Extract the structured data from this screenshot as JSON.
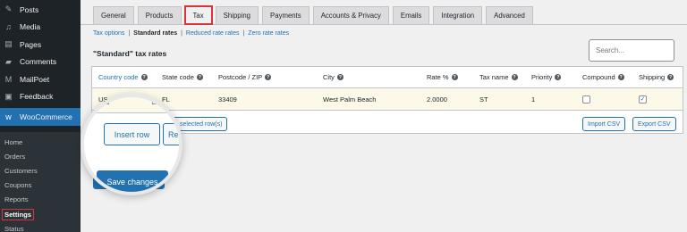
{
  "sidebar": {
    "items": [
      {
        "icon": "pin-icon",
        "glyph": "✎",
        "label": "Posts"
      },
      {
        "icon": "media-icon",
        "glyph": "♫",
        "label": "Media"
      },
      {
        "icon": "pages-icon",
        "glyph": "▤",
        "label": "Pages"
      },
      {
        "icon": "comments-icon",
        "glyph": "▰",
        "label": "Comments"
      },
      {
        "icon": "mailpoet-icon",
        "glyph": "M",
        "label": "MailPoet"
      },
      {
        "icon": "feedback-icon",
        "glyph": "▣",
        "label": "Feedback"
      }
    ],
    "woocommerce": {
      "glyph": "w",
      "label": "WooCommerce"
    },
    "submenu": [
      "Home",
      "Orders",
      "Customers",
      "Coupons",
      "Reports",
      "Settings",
      "Status"
    ]
  },
  "tabs": [
    "General",
    "Products",
    "Tax",
    "Shipping",
    "Payments",
    "Accounts & Privacy",
    "Emails",
    "Integration",
    "Advanced"
  ],
  "subnav": {
    "tax_options": "Tax options",
    "standard": "Standard rates",
    "reduced": "Reduced rate rates",
    "zero": "Zero rate rates",
    "sep": "|"
  },
  "section_title": "\"Standard\" tax rates",
  "search_placeholder": "Search...",
  "table": {
    "headers": [
      "Country code",
      "State code",
      "Postcode / ZIP",
      "City",
      "Rate %",
      "Tax name",
      "Priority",
      "Compound",
      "Shipping"
    ],
    "row": {
      "country": "US",
      "state": "FL",
      "postcode": "33409",
      "city": "West Palm Beach",
      "rate": "2.0000",
      "tax_name": "ST",
      "priority": "1",
      "compound": false,
      "shipping": true
    }
  },
  "buttons": {
    "insert_row": "Insert row",
    "remove_partial": "Re",
    "remove_tail": "selected row(s)",
    "import_csv": "Import CSV",
    "export_csv": "Export CSV",
    "save_changes": "Save changes"
  },
  "colors": {
    "accent": "#2271b1",
    "highlight": "#d63638",
    "sidebar": "#1d2327",
    "row_bg": "#fcf9e8"
  }
}
